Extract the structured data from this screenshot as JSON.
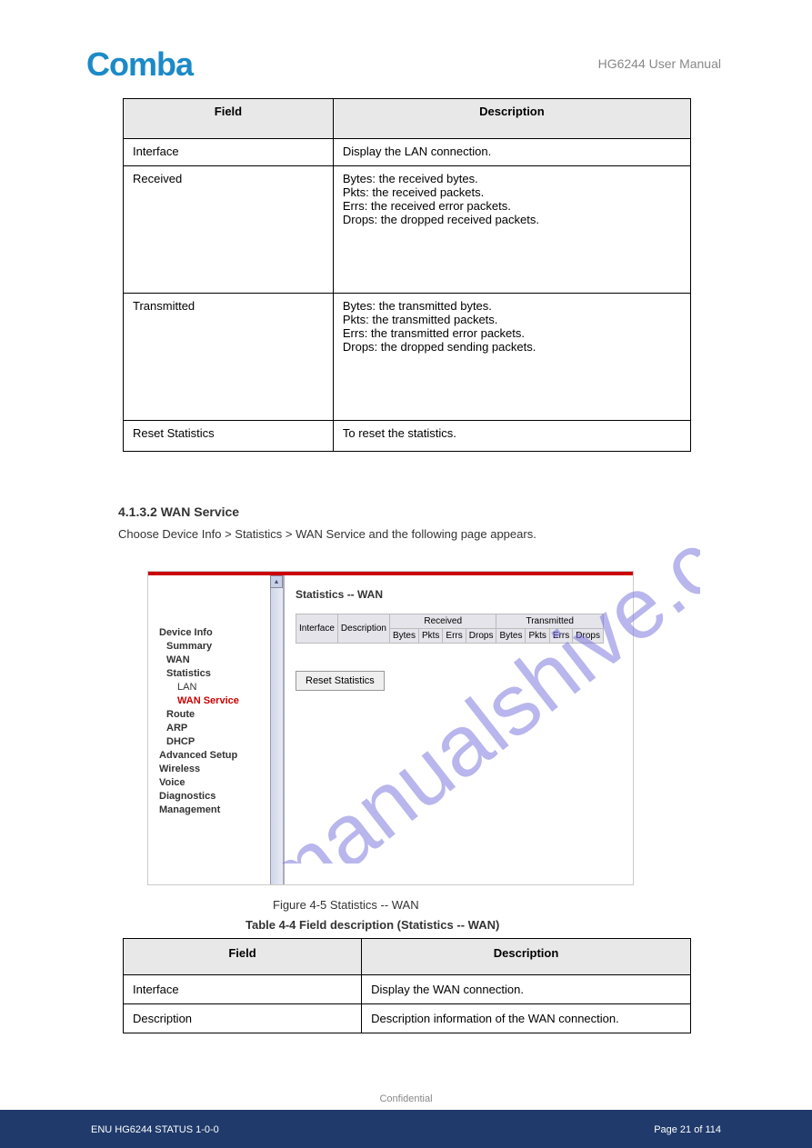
{
  "header": {
    "logo": "Comba",
    "doc_title": "HG6244 User Manual"
  },
  "table1": {
    "headers": [
      "Field",
      "Description"
    ],
    "rows": [
      {
        "field": "Interface",
        "desc": "Display the LAN connection."
      },
      {
        "field": "Received",
        "desc": "Bytes: the received bytes.\nPkts: the received packets.\nErrs: the received error packets.\nDrops: the dropped received packets."
      },
      {
        "field": "Transmitted",
        "desc": "Bytes: the transmitted bytes.\nPkts: the transmitted packets.\nErrs: the transmitted error packets.\nDrops: the dropped sending packets."
      },
      {
        "field": "Reset Statistics",
        "desc": "To reset the statistics."
      }
    ]
  },
  "section": {
    "heading": "4.1.3.2 WAN Service",
    "body": "Choose Device Info > Statistics > WAN Service and the following page appears."
  },
  "screenshot": {
    "heading": "Statistics -- WAN",
    "nav": {
      "root": "Device Info",
      "summary": "Summary",
      "wan": "WAN",
      "statistics": "Statistics",
      "lan": "LAN",
      "wan_service": "WAN Service",
      "route": "Route",
      "arp": "ARP",
      "dhcp": "DHCP",
      "advanced": "Advanced Setup",
      "wireless": "Wireless",
      "voice": "Voice",
      "diagnostics": "Diagnostics",
      "management": "Management"
    },
    "stats_headers": {
      "interface": "Interface",
      "description": "Description",
      "received": "Received",
      "transmitted": "Transmitted",
      "bytes": "Bytes",
      "pkts": "Pkts",
      "errs": "Errs",
      "drops": "Drops"
    },
    "reset_btn": "Reset Statistics"
  },
  "figure_caption": "Figure 4-5 Statistics -- WAN",
  "table2_caption": "Table 4-4 Field description (Statistics -- WAN)",
  "table2": {
    "headers": [
      "Field",
      "Description"
    ],
    "rows": [
      {
        "field": "Interface",
        "desc": "Display the WAN connection."
      },
      {
        "field": "Description",
        "desc": "Description information of the WAN connection."
      }
    ]
  },
  "footer": {
    "confidential": "Confidential",
    "left": "ENU HG6244 STATUS 1-0-0",
    "right": "Page 21 of 114"
  },
  "watermark": "manualshive.com"
}
